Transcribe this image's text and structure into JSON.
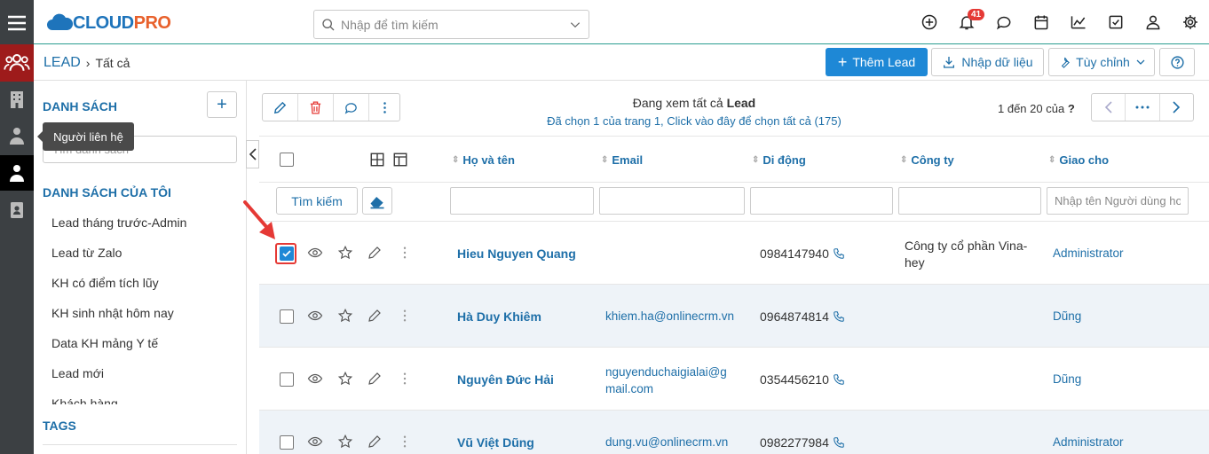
{
  "app": {
    "logo_text_a": "CLOUD",
    "logo_text_b": "PRO",
    "search_placeholder": "Nhập để tìm kiếm",
    "notification_count": "41"
  },
  "breadcrumb": {
    "module": "LEAD",
    "current": "Tất cả"
  },
  "actions": {
    "add_lead": "Thêm Lead",
    "import": "Nhập dữ liệu",
    "customize": "Tùy chỉnh"
  },
  "sidebar": {
    "list_heading": "DANH SÁCH",
    "search_placeholder": "Tìm danh sách",
    "my_list_heading": "DANH SÁCH CỦA TÔI",
    "items": [
      {
        "label": "Lead tháng trước-Admin"
      },
      {
        "label": "Lead từ Zalo"
      },
      {
        "label": "KH có điểm tích lũy"
      },
      {
        "label": "KH sinh nhật hôm nay"
      },
      {
        "label": "Data KH mảng Y tế"
      },
      {
        "label": "Lead mới"
      },
      {
        "label": "Khách hàng"
      }
    ],
    "tags_heading": "TAGS",
    "tooltip": "Người liên hệ"
  },
  "listview": {
    "viewing_prefix": "Đang xem tất cả ",
    "viewing_module": "Lead",
    "selected_info": "Đã chọn 1 của trang 1, Click vào đây để chọn tất cả (175)",
    "paging": "1 đến 20 của",
    "paging_unknown": "?",
    "search_button": "Tìm kiếm",
    "columns": [
      {
        "label": "Họ và tên"
      },
      {
        "label": "Email"
      },
      {
        "label": "Di động"
      },
      {
        "label": "Công ty"
      },
      {
        "label": "Giao cho"
      }
    ],
    "assignee_filter_placeholder": "Nhập tên Người dùng hoặc Nhóm",
    "rows": [
      {
        "name": "Hieu Nguyen Quang",
        "email_line1": "",
        "email_line2": "",
        "mobile": "0984147940",
        "company_line1": "Công ty cổ phần Vina-",
        "company_line2": "hey",
        "assigned": "Administrator",
        "checked": true
      },
      {
        "name": "Hà Duy Khiêm",
        "email_line1": "khiem.ha@onlinecrm.vn",
        "email_line2": "",
        "mobile": "0964874814",
        "company_line1": "",
        "company_line2": "",
        "assigned": "Dũng",
        "checked": false
      },
      {
        "name": "Nguyên Đức Hải",
        "email_line1": "nguyenduchaigialai@g",
        "email_line2": "mail.com",
        "mobile": "0354456210",
        "company_line1": "",
        "company_line2": "",
        "assigned": "Dũng",
        "checked": false
      },
      {
        "name": "Vũ Việt Dũng",
        "email_line1": "dung.vu@onlinecrm.vn",
        "email_line2": "",
        "mobile": "0982277984",
        "company_line1": "",
        "company_line2": "",
        "assigned": "Administrator",
        "checked": false
      }
    ]
  },
  "colors": {
    "primary": "#1e88d6",
    "link": "#1e6fa8",
    "rail": "#3c4043",
    "rail_active": "#9e1b1b",
    "accent_red": "#e53935"
  }
}
